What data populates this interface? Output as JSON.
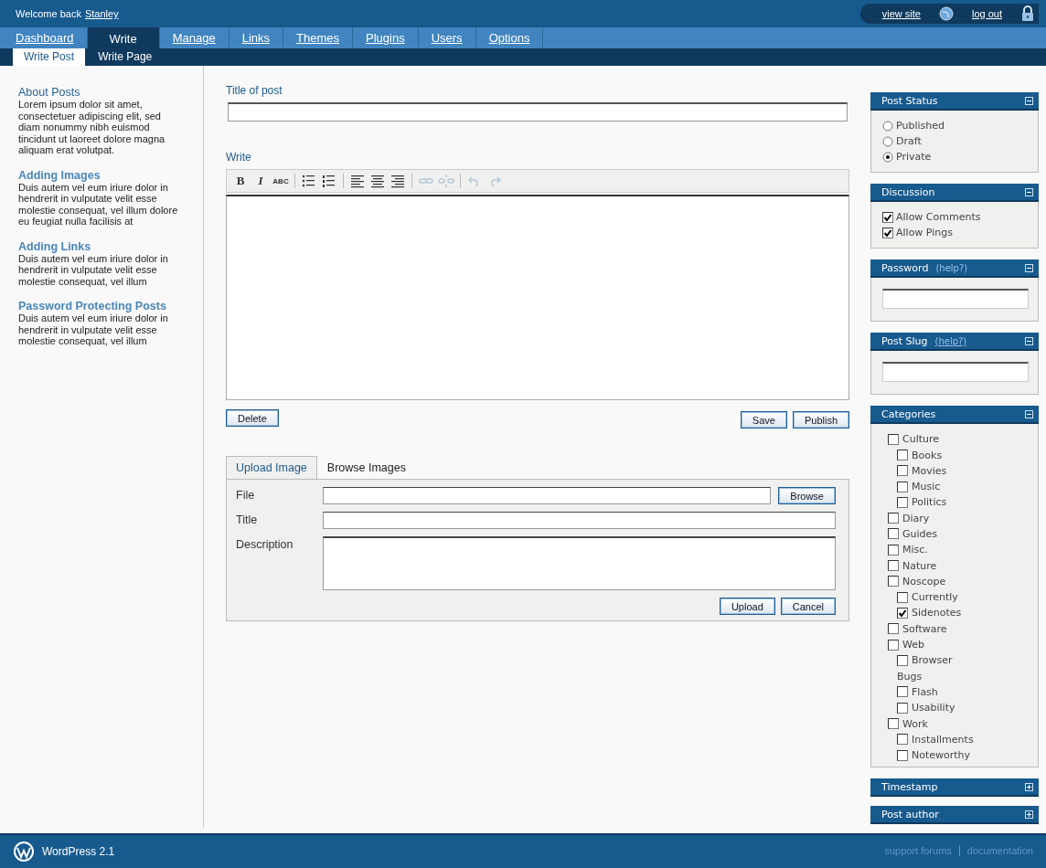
{
  "header": {
    "welcome": "Welcome back",
    "user": "Stanley",
    "links": [
      {
        "label": "view site",
        "kind": "site"
      },
      {
        "label": "log out",
        "kind": "logout"
      }
    ]
  },
  "nav": [
    {
      "label": "Dashboard",
      "selected": false
    },
    {
      "label": "Write",
      "selected": true
    },
    {
      "label": "Manage",
      "selected": false
    },
    {
      "label": "Links",
      "selected": false
    },
    {
      "label": "Themes",
      "selected": false
    },
    {
      "label": "Plugins",
      "selected": false
    },
    {
      "label": "Users",
      "selected": false
    },
    {
      "label": "Options",
      "selected": false
    }
  ],
  "subnav": [
    {
      "label": "Write Post",
      "selected": true
    },
    {
      "label": "Write Page",
      "selected": false
    }
  ],
  "help": [
    {
      "title": "About Posts",
      "text": "Lorem ipsum dolor sit amet, consectetuer adipiscing elit, sed diam nonummy nibh euismod tincidunt ut laoreet dolore magna aliquam erat volutpat."
    },
    {
      "title": "Adding Images",
      "text": "Duis autem vel eum iriure dolor in hendrerit in vulputate velit esse molestie consequat, vel illum dolore eu feugiat nulla facilisis at"
    },
    {
      "title": "Adding Links",
      "text": "Duis autem vel eum iriure dolor in hendrerit in vulputate velit esse molestie consequat, vel illum"
    },
    {
      "title": "Password Protecting Posts",
      "text": "Duis autem vel eum iriure dolor in hendrerit in vulputate velit esse molestie consequat, vel illum"
    }
  ],
  "post": {
    "title_label": "Title of post",
    "write_label": "Write",
    "toolbar": [
      {
        "kind": "bold",
        "glyph": "B",
        "disabled": false
      },
      {
        "kind": "italic",
        "glyph": "I",
        "disabled": false
      },
      {
        "kind": "strike",
        "glyph": "ABC",
        "disabled": false
      },
      {
        "kind": "separator"
      },
      {
        "kind": "bullets",
        "disabled": false
      },
      {
        "kind": "numbers",
        "disabled": false
      },
      {
        "kind": "separator"
      },
      {
        "kind": "align-left",
        "disabled": false
      },
      {
        "kind": "align-center",
        "disabled": false
      },
      {
        "kind": "align-right",
        "disabled": false
      },
      {
        "kind": "separator"
      },
      {
        "kind": "link",
        "disabled": true
      },
      {
        "kind": "unlink",
        "disabled": true
      },
      {
        "kind": "separator"
      },
      {
        "kind": "undo",
        "disabled": true
      },
      {
        "kind": "redo",
        "disabled": true
      }
    ],
    "delete": "Delete",
    "save": "Save",
    "publish": "Publish"
  },
  "upload": {
    "tabs": [
      {
        "label": "Upload Image",
        "selected": true
      },
      {
        "label": "Browse Images",
        "selected": false
      }
    ],
    "fields": [
      {
        "kind": "file",
        "label": "File",
        "button": "Browse"
      },
      {
        "kind": "text",
        "label": "Title"
      },
      {
        "kind": "textarea",
        "label": "Description"
      }
    ],
    "buttons": [
      "Upload",
      "Cancel"
    ]
  },
  "panels": [
    {
      "title": "Post Status",
      "kind": "radios",
      "expanded": true,
      "options": [
        {
          "label": "Published",
          "selected": false
        },
        {
          "label": "Draft",
          "selected": false
        },
        {
          "label": "Private",
          "selected": true
        }
      ]
    },
    {
      "title": "Discussion",
      "kind": "checks",
      "expanded": true,
      "options": [
        {
          "label": "Allow Comments",
          "checked": true
        },
        {
          "label": "Allow Pings",
          "checked": true
        }
      ]
    },
    {
      "title": "Password",
      "help": "(help?)",
      "kind": "field",
      "expanded": true
    },
    {
      "title": "Post Slug",
      "help": "(help?)",
      "kind": "field",
      "expanded": true
    },
    {
      "title": "Categories",
      "kind": "tree",
      "expanded": true,
      "items": [
        {
          "label": "Culture",
          "kind": "checkbox",
          "checked": false,
          "children": [
            {
              "label": "Books",
              "kind": "checkbox",
              "checked": false
            },
            {
              "label": "Movies",
              "kind": "checkbox",
              "checked": false
            },
            {
              "label": "Music",
              "kind": "checkbox",
              "checked": false
            },
            {
              "label": "Politics",
              "kind": "checkbox",
              "checked": false
            }
          ]
        },
        {
          "label": "Diary",
          "kind": "checkbox",
          "checked": false
        },
        {
          "label": "Guides",
          "kind": "checkbox",
          "checked": false
        },
        {
          "label": "Misc.",
          "kind": "checkbox",
          "checked": false
        },
        {
          "label": "Nature",
          "kind": "checkbox",
          "checked": false
        },
        {
          "label": "Noscope",
          "kind": "checkbox",
          "checked": false,
          "children": [
            {
              "label": "Currently",
              "kind": "checkbox",
              "checked": false
            },
            {
              "label": "Sidenotes",
              "kind": "checkbox",
              "checked": true
            }
          ]
        },
        {
          "label": "Software",
          "kind": "checkbox",
          "checked": false
        },
        {
          "label": "Web",
          "kind": "checkbox",
          "checked": false,
          "children": [
            {
              "label": "Browser",
              "kind": "checkbox",
              "checked": false
            },
            {
              "label": "Bugs",
              "kind": "label"
            },
            {
              "label": "Flash",
              "kind": "checkbox",
              "checked": false
            },
            {
              "label": "Usability",
              "kind": "checkbox",
              "checked": false
            }
          ]
        },
        {
          "label": "Work",
          "kind": "checkbox",
          "checked": false,
          "children": [
            {
              "label": "Installments",
              "kind": "checkbox",
              "checked": false
            },
            {
              "label": "Noteworthy",
              "kind": "checkbox",
              "checked": false
            }
          ]
        }
      ]
    },
    {
      "title": "Timestamp",
      "expanded": false
    },
    {
      "title": "Post author",
      "expanded": false
    }
  ],
  "footer": {
    "product": "WordPress 2.1",
    "links": [
      "support forums",
      "documentation"
    ]
  }
}
